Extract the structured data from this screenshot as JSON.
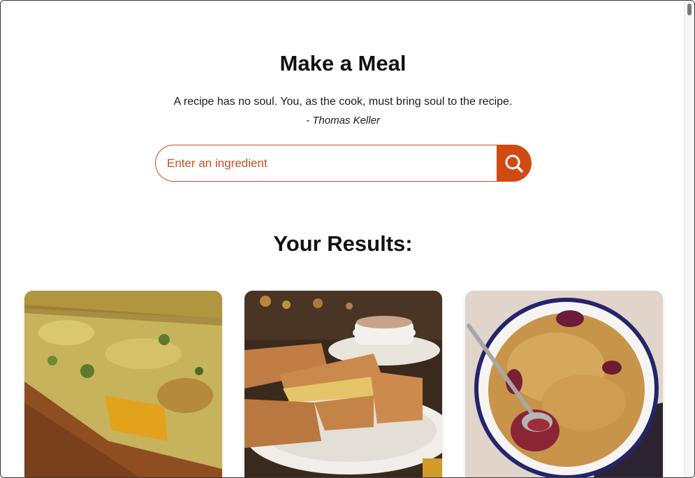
{
  "header": {
    "title": "Make a Meal",
    "quote": "A recipe has no soul. You, as the cook, must bring soul to the recipe.",
    "author": "- Thomas Keller"
  },
  "search": {
    "placeholder": "Enter an ingredient",
    "value": "",
    "button_icon": "search-icon"
  },
  "results": {
    "heading": "Your Results:",
    "cards": [
      {
        "image": "vegetable-frittata-squares"
      },
      {
        "image": "stuffed-pancake-turnovers-with-tea"
      },
      {
        "image": "berry-crumble-in-enamel-dish"
      }
    ]
  },
  "colors": {
    "accent": "#d04a12",
    "input_border": "#c7501b",
    "text": "#111111"
  }
}
